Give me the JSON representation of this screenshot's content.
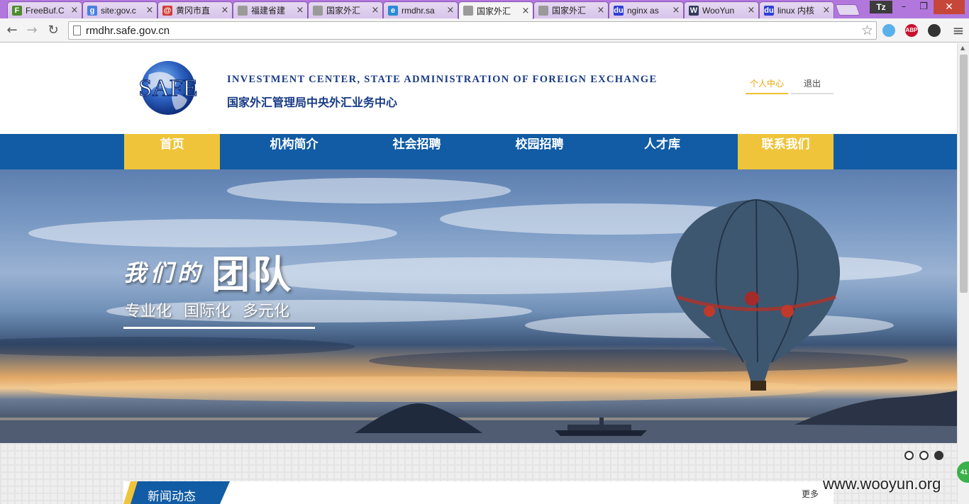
{
  "browser": {
    "tabs": [
      {
        "title": "FreeBuf.C",
        "icon": "freebuf-favicon",
        "color": "#4e8b2e",
        "glyph": "F",
        "active": false
      },
      {
        "title": "site:gov.c",
        "icon": "google-favicon",
        "color": "#4a7fe0",
        "glyph": "g",
        "active": false
      },
      {
        "title": "黄冈市直",
        "icon": "hg-favicon",
        "color": "#d23b32",
        "glyph": "@",
        "active": false
      },
      {
        "title": "福建省建",
        "icon": "page-favicon",
        "color": "#9a9a9a",
        "glyph": "",
        "active": false
      },
      {
        "title": "国家外汇",
        "icon": "page-favicon",
        "color": "#9a9a9a",
        "glyph": "",
        "active": false
      },
      {
        "title": "rmdhr.sa",
        "icon": "edge-favicon",
        "color": "#2a8ad4",
        "glyph": "e",
        "active": false
      },
      {
        "title": "国家外汇",
        "icon": "page-favicon",
        "color": "#9a9a9a",
        "glyph": "",
        "active": true
      },
      {
        "title": "国家外汇",
        "icon": "page-favicon",
        "color": "#9a9a9a",
        "glyph": "",
        "active": false
      },
      {
        "title": "nginx as",
        "icon": "baidu-favicon",
        "color": "#2d3fd6",
        "glyph": "du",
        "active": false
      },
      {
        "title": "WooYun",
        "icon": "wooyun-favicon",
        "color": "#333a5a",
        "glyph": "W",
        "active": false
      },
      {
        "title": "linux 内核",
        "icon": "baidu-favicon",
        "color": "#2d3fd6",
        "glyph": "du",
        "active": false
      }
    ],
    "tab_close_glyph": "×",
    "profile": "Tz",
    "window_buttons": {
      "minimize": "–",
      "maximize": "❐",
      "close": "✕"
    },
    "nav": {
      "back": "←",
      "forward": "→",
      "reload": "↻"
    },
    "url": "rmdhr.safe.gov.cn",
    "star": "☆",
    "extensions": [
      {
        "name": "circle-extension-icon",
        "label": "",
        "color": "#5ab0ea"
      },
      {
        "name": "adblock-plus-icon",
        "label": "ABP",
        "color": "#c8102e"
      },
      {
        "name": "incognito-extension-icon",
        "label": "",
        "color": "#333333"
      }
    ],
    "menu_glyph": "≡"
  },
  "header": {
    "logo_text": "SAFE",
    "title_en": "INVESTMENT CENTER, STATE ADMINISTRATION OF FOREIGN EXCHANGE",
    "title_cn": "国家外汇管理局中央外汇业务中心",
    "user_center": "个人中心",
    "logout": "退出"
  },
  "nav": {
    "items": [
      {
        "label": "首页",
        "highlight": true
      },
      {
        "label": "机构简介",
        "highlight": false
      },
      {
        "label": "社会招聘",
        "highlight": false
      },
      {
        "label": "校园招聘",
        "highlight": false
      },
      {
        "label": "人才库",
        "highlight": false
      },
      {
        "label": "联系我们",
        "highlight": true
      }
    ],
    "bg_color": "#115ca4",
    "highlight_color": "#f0c43a"
  },
  "banner": {
    "script_text": "我们的",
    "big_text": "团队",
    "subtitle": "专业化 国际化 多元化",
    "carousel_total": 3,
    "carousel_active": 3
  },
  "news": {
    "title": "新闻动态",
    "more": "更多"
  },
  "overlay": {
    "badge": "41",
    "watermark": "www.wooyun.org"
  }
}
